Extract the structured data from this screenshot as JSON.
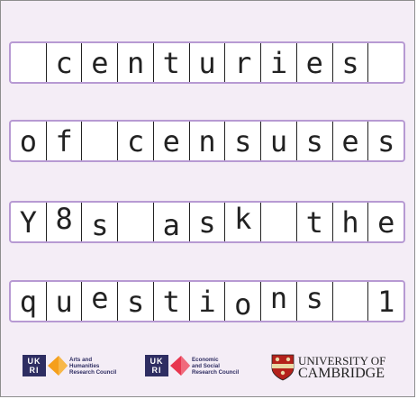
{
  "rows": [
    [
      "",
      "c",
      "e",
      "n",
      "t",
      "u",
      "r",
      "i",
      "e",
      "s",
      ""
    ],
    [
      "o",
      "f",
      "",
      "c",
      "e",
      "n",
      "s",
      "u",
      "s",
      "e",
      "s"
    ],
    [
      "Y",
      "8",
      "s",
      "",
      "a",
      "s",
      "k",
      "",
      "t",
      "h",
      "e"
    ],
    [
      "q",
      "u",
      "e",
      "s",
      "t",
      "i",
      "o",
      "n",
      "s",
      "",
      "1"
    ]
  ],
  "logos": {
    "ahrc": {
      "mark": [
        "UK",
        "RI"
      ],
      "text": [
        "Arts and",
        "Humanities",
        "Research Council"
      ],
      "color": "#f59f1b"
    },
    "esrc": {
      "mark": [
        "UK",
        "RI"
      ],
      "text": [
        "Economic",
        "and Social",
        "Research Council"
      ],
      "color": "#e8364f"
    },
    "cambridge": {
      "line1": "UNIVERSITY OF",
      "line2": "CAMBRIDGE",
      "shield_color": "#b4211b"
    }
  },
  "colors": {
    "background": "#f4edf6",
    "row_border": "#b79ad3"
  }
}
